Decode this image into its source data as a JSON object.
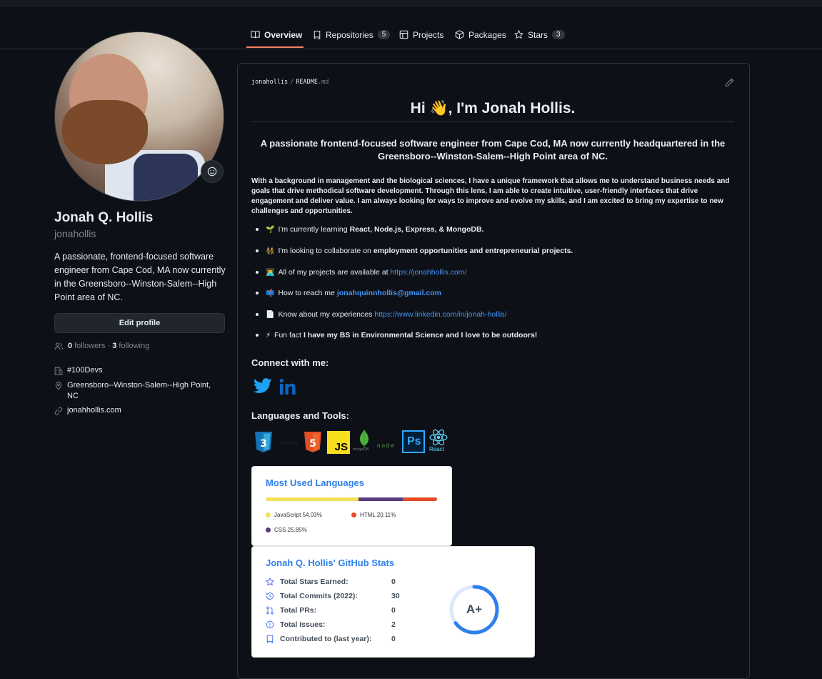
{
  "tabs": [
    {
      "label": "Overview",
      "icon": "book-icon"
    },
    {
      "label": "Repositories",
      "icon": "repo-icon",
      "count": "5"
    },
    {
      "label": "Projects",
      "icon": "table-icon"
    },
    {
      "label": "Packages",
      "icon": "package-icon"
    },
    {
      "label": "Stars",
      "icon": "star-icon",
      "count": "3"
    }
  ],
  "profile": {
    "name": "Jonah Q. Hollis",
    "login": "jonahollis",
    "bio": "A passionate, frontend-focused software engineer from Cape Cod, MA now currently in the Greensboro--Winston-Salem--High Point area of NC.",
    "edit_label": "Edit profile",
    "followers_count": "0",
    "followers_label": "followers",
    "following_count": "3",
    "following_label": "following",
    "organization": "#100Devs",
    "location": "Greensboro--Winston-Salem--High Point, NC",
    "website": "jonahhollis.com"
  },
  "readme": {
    "owner": "jonahollis",
    "file": "README",
    "ext": ".md",
    "greeting": "Hi 👋, I'm Jonah Hollis.",
    "tagline": "A passionate frontend-focused software engineer from Cape Cod, MA now currently headquartered in the Greensboro--Winston-Salem--High Point area of NC.",
    "paragraph": "With a background in management and the biological sciences, I have a unique framework that allows me to understand business needs and goals that drive methodical software development. Through this lens, I am able to create intuitive, user-friendly interfaces that drive engagement and deliver value. I am always looking for ways to improve and evolve my skills, and I am excited to bring my expertise to new challenges and opportunities.",
    "bullets": [
      {
        "emoji": "🌱",
        "text": "I'm currently learning",
        "strong": "React, Node.js, Express, & MongoDB."
      },
      {
        "emoji": "👯",
        "text": "I'm looking to collaborate on",
        "strong": "employment opportunities and entrepreneurial projects."
      },
      {
        "emoji": "👨‍💻",
        "text": "All of my projects are available at",
        "link": "https://jonahhollis.com/"
      },
      {
        "emoji": "📫",
        "text": "How to reach me",
        "link": "jonahquinnhollis@gmail.com"
      },
      {
        "emoji": "📄",
        "text": "Know about my experiences",
        "link": "https://www.linkedin.com/in/jonah-hollis/"
      },
      {
        "emoji": "⚡",
        "text": "Fun fact",
        "strong": "I have my BS in Environmental Science and I love to be outdoors!"
      }
    ],
    "connect_heading": "Connect with me:",
    "tools_heading": "Languages and Tools:",
    "tool_labels": {
      "js": "JS",
      "ps": "Ps",
      "react": "React",
      "mongo": "mongoDB",
      "node": "node"
    }
  },
  "languages_card": {
    "title": "Most Used Languages",
    "items": [
      {
        "name": "JavaScript",
        "percent": 54.03,
        "label": "JavaScript 54.03%",
        "color": "#f1e05a"
      },
      {
        "name": "CSS",
        "percent": 25.85,
        "label": "CSS 25.85%",
        "color": "#563d7c"
      },
      {
        "name": "HTML",
        "percent": 20.11,
        "label": "HTML 20.11%",
        "color": "#e34c26"
      }
    ]
  },
  "stats_card": {
    "title": "Jonah Q. Hollis' GitHub Stats",
    "rows": [
      {
        "label": "Total Stars Earned:",
        "value": "0",
        "icon": "star-icon"
      },
      {
        "label": "Total Commits (2022):",
        "value": "30",
        "icon": "history-icon"
      },
      {
        "label": "Total PRs:",
        "value": "0",
        "icon": "pull-request-icon"
      },
      {
        "label": "Total Issues:",
        "value": "2",
        "icon": "issue-icon"
      },
      {
        "label": "Contributed to (last year):",
        "value": "0",
        "icon": "repo-icon"
      }
    ],
    "rank": "A+",
    "rank_progress": 0.65
  },
  "colors": {
    "accent": "#2f80ed",
    "link": "#4493f8",
    "underline": "#f78166"
  }
}
